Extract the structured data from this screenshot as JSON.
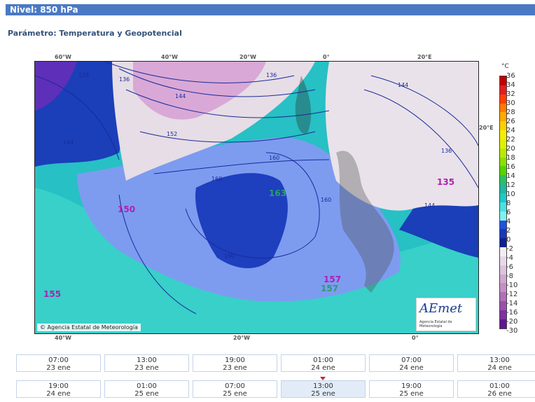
{
  "header": {
    "level": "Nivel: 850 hPa"
  },
  "param": {
    "label": "Parámetro: Temperatura y Geopotencial"
  },
  "map": {
    "lon_top": [
      "60°W",
      "40°W",
      "20°W",
      "0°",
      "20°E"
    ],
    "lon_bottom": [
      "40°W",
      "20°W",
      "0°"
    ],
    "lat_right": "20°E",
    "copyright": "Agencia Estatal de Meteorología",
    "logo_text": "AEmet",
    "logo_sub": "Agencia Estatal de Meteorología",
    "contour_labels": [
      "128",
      "136",
      "136",
      "144",
      "144",
      "152",
      "144",
      "160",
      "160",
      "160",
      "160",
      "144",
      "136"
    ],
    "centers": [
      {
        "value": "150",
        "color": "#b020b0"
      },
      {
        "value": "155",
        "color": "#b020b0"
      },
      {
        "value": "163",
        "color": "#2a9d6a"
      },
      {
        "value": "157",
        "color": "#b020b0"
      },
      {
        "value": "157",
        "color": "#2a9d6a"
      },
      {
        "value": "135",
        "color": "#b020b0"
      }
    ]
  },
  "colorbar": {
    "unit": "°C",
    "labels": [
      "36",
      "34",
      "32",
      "30",
      "28",
      "26",
      "24",
      "22",
      "20",
      "18",
      "16",
      "14",
      "12",
      "10",
      "8",
      "6",
      "4",
      "2",
      "0",
      "-2",
      "-4",
      "-6",
      "-8",
      "-10",
      "-12",
      "-14",
      "-16",
      "-20",
      "-30"
    ]
  },
  "timeline": [
    {
      "time": "07:00",
      "date": "23 ene",
      "active": false
    },
    {
      "time": "13:00",
      "date": "23 ene",
      "active": false
    },
    {
      "time": "19:00",
      "date": "23 ene",
      "active": false
    },
    {
      "time": "01:00",
      "date": "24 ene",
      "active": false
    },
    {
      "time": "07:00",
      "date": "24 ene",
      "active": false
    },
    {
      "time": "13:00",
      "date": "24 ene",
      "active": false
    },
    {
      "time": "19:00",
      "date": "24 ene",
      "active": false
    },
    {
      "time": "01:00",
      "date": "25 ene",
      "active": false
    },
    {
      "time": "07:00",
      "date": "25 ene",
      "active": false
    },
    {
      "time": "13:00",
      "date": "25 ene",
      "active": true
    },
    {
      "time": "19:00",
      "date": "25 ene",
      "active": false
    },
    {
      "time": "01:00",
      "date": "26 ene",
      "active": false
    }
  ]
}
